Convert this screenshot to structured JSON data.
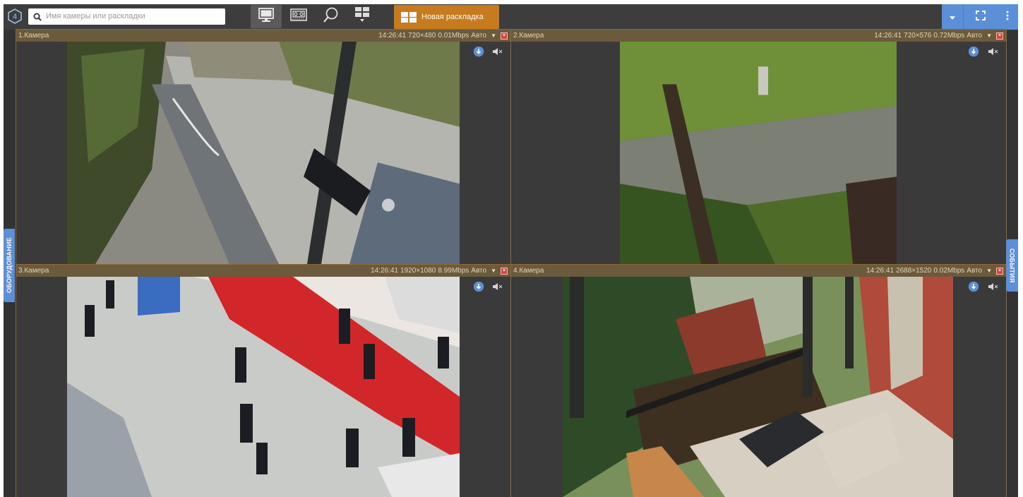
{
  "app": {
    "logo_label": "4",
    "accent": "#5b8fd8"
  },
  "search": {
    "placeholder": "Имя камеры или раскладки",
    "value": ""
  },
  "toolbar": {
    "modes": [
      {
        "icon": "monitor-icon",
        "active": true
      },
      {
        "icon": "archive-tape-icon",
        "active": false
      },
      {
        "icon": "search-magnifier-icon",
        "active": false
      },
      {
        "icon": "layouts-grid-icon",
        "active": false
      }
    ],
    "new_layout_label": "Новая раскладка",
    "new_layout_color": "#c87a1e"
  },
  "side_tabs": {
    "left": "ОБОРУДОВАНИЕ",
    "right": "СОБЫТИЯ"
  },
  "cameras": [
    {
      "name": "1.Камера",
      "time": "14:26:41",
      "resolution": "720×480",
      "bitrate": "0.01Mbps",
      "stream": "Авто"
    },
    {
      "name": "2.Камера",
      "time": "14:26:41",
      "resolution": "720×576",
      "bitrate": "0.72Mbps",
      "stream": "Авто"
    },
    {
      "name": "3.Камера",
      "time": "14:26:41",
      "resolution": "1920×1080",
      "bitrate": "8.99Mbps",
      "stream": "Авто"
    },
    {
      "name": "4.Камера",
      "time": "14:26:41",
      "resolution": "2688×1520",
      "bitrate": "0.02Mbps",
      "stream": "Авто"
    }
  ]
}
